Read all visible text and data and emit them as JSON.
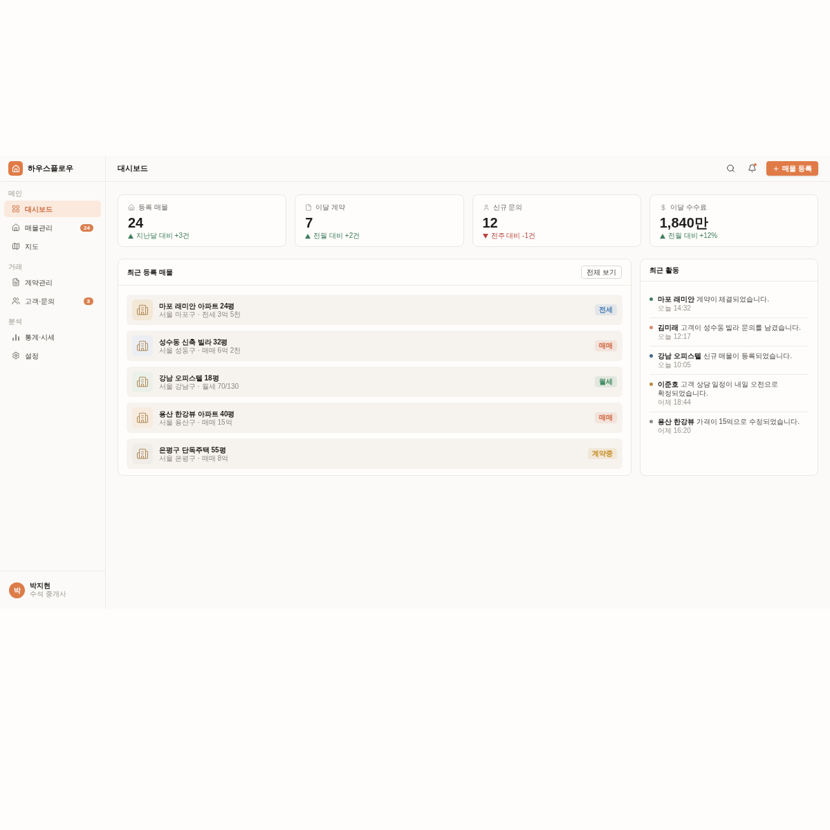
{
  "brand": {
    "name": "하우스플로우"
  },
  "sidebar": {
    "sections": [
      {
        "label": "메인",
        "items": [
          {
            "label": "대시보드",
            "selected": true
          },
          {
            "label": "매물관리",
            "selected": false,
            "badge": "24"
          },
          {
            "label": "지도",
            "selected": false
          }
        ]
      },
      {
        "label": "거래",
        "items": [
          {
            "label": "계약관리",
            "selected": false
          },
          {
            "label": "고객·문의",
            "selected": false,
            "badge": "3"
          }
        ]
      },
      {
        "label": "분석",
        "items": [
          {
            "label": "통계·시세",
            "selected": false
          },
          {
            "label": "설정",
            "selected": false
          }
        ]
      }
    ],
    "user": {
      "avatar_initial": "박",
      "name": "박지현",
      "role": "수석 중개사"
    }
  },
  "header": {
    "title": "대시보드",
    "notifications_unread": true,
    "primary_button": {
      "label": "매물 등록"
    }
  },
  "stats": [
    {
      "label": "등록 매물",
      "value": "24",
      "increase": true,
      "change": "지난달 대비 +3건"
    },
    {
      "label": "이달 계약",
      "value": "7",
      "increase": true,
      "change": "전월 대비 +2건"
    },
    {
      "label": "신규 문의",
      "value": "12",
      "increase": false,
      "change": "전주 대비 -1건"
    },
    {
      "label": "이달 수수료",
      "value": "1,840만",
      "increase": true,
      "change": "전월 대비 +12%"
    }
  ],
  "listings": {
    "title": "최근 등록 매물",
    "view_all": "전체 보기",
    "items": [
      {
        "title": "마포 래미안 아파트 24평",
        "subtitle": "서울 마포구 · 전세 3억 5천",
        "color": "#f3e7d5",
        "tag": {
          "label": "전세",
          "color": "#4a7db5"
        }
      },
      {
        "title": "성수동 신축 빌라 32평",
        "subtitle": "서울 성동구 · 매매 6억 2천",
        "color": "#ebeef2",
        "tag": {
          "label": "매매",
          "color": "#d0643c"
        }
      },
      {
        "title": "강남 오피스텔 18평",
        "subtitle": "서울 강남구 · 월세 70/130",
        "color": "#ebf1e9",
        "tag": {
          "label": "월세",
          "color": "#3f8a5f"
        }
      },
      {
        "title": "용산 한강뷰 아파트 40평",
        "subtitle": "서울 용산구 · 매매 15억",
        "color": "#f8ebdf",
        "tag": {
          "label": "매매",
          "color": "#d0643c"
        }
      },
      {
        "title": "은평구 단독주택 55평",
        "subtitle": "서울 은평구 · 매매 8억",
        "color": "#f0ece7",
        "tag": {
          "label": "계약중",
          "color": "#c58a1c"
        }
      }
    ]
  },
  "activity": {
    "title": "최근 활동",
    "items": [
      {
        "text": "**마포 래미안** 계약이 체결되었습니다.",
        "time": "오늘 14:32",
        "color": "#3f7d64"
      },
      {
        "text": "**김미래** 고객이 성수동 빌라 문의를 남겼습니다.",
        "time": "오늘 12:17",
        "color": "#d98b70"
      },
      {
        "text": "**강남 오피스텔** 신규 매물이 등록되었습니다.",
        "time": "오늘 10:05",
        "color": "#44658a"
      },
      {
        "text": "**이준호** 고객 상담 일정이 내일 오전으로 확정되었습니다.",
        "time": "어제 18:44",
        "color": "#b88c3e"
      },
      {
        "text": "**용산 한강뷰** 가격이 15억으로 수정되었습니다.",
        "time": "어제 16:20",
        "color": "#8c8c8c"
      }
    ]
  }
}
